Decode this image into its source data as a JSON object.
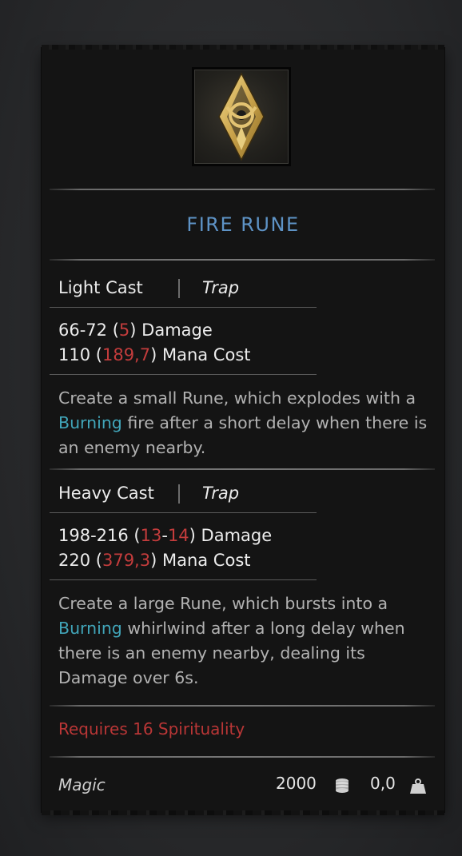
{
  "item": {
    "icon": "fire-rune-icon",
    "title": "FIRE RUNE"
  },
  "light_cast": {
    "label": "Light Cast",
    "type": "Trap",
    "damage_range": "66-72",
    "damage_open": " (",
    "damage_bonus": "5",
    "damage_close": ") Damage",
    "mana_base": "110",
    "mana_open": " (",
    "mana_bonus": "189,7",
    "mana_close": ") Mana Cost",
    "desc_part1": "Create a small Rune, which explodes with a ",
    "keyword": "Burning",
    "desc_part2": " fire after a short delay when there is an enemy nearby."
  },
  "heavy_cast": {
    "label": "Heavy Cast",
    "type": "Trap",
    "damage_range": "198-216",
    "damage_open": " (",
    "damage_bonus_min": "13",
    "damage_dash": "-",
    "damage_bonus_max": "14",
    "damage_close": ") Damage",
    "mana_base": "220",
    "mana_open": " (",
    "mana_bonus": "379,3",
    "mana_close": ") Mana Cost",
    "keyword": "Burning",
    "desc_part1": "Create a large Rune, which bursts into a ",
    "desc_part2": " whirlwind after a long delay when there is an enemy nearby, dealing its Damage over 6s."
  },
  "requirement": "Requires 16 Spirituality",
  "footer": {
    "category": "Magic",
    "price": "2000",
    "price_icon": "coins-icon",
    "weight": "0,0",
    "weight_icon": "weight-icon"
  },
  "colors": {
    "title": "#5e93c6",
    "bonus": "#c33c3c",
    "keyword": "#41a5b9",
    "requirement": "#b93636"
  }
}
